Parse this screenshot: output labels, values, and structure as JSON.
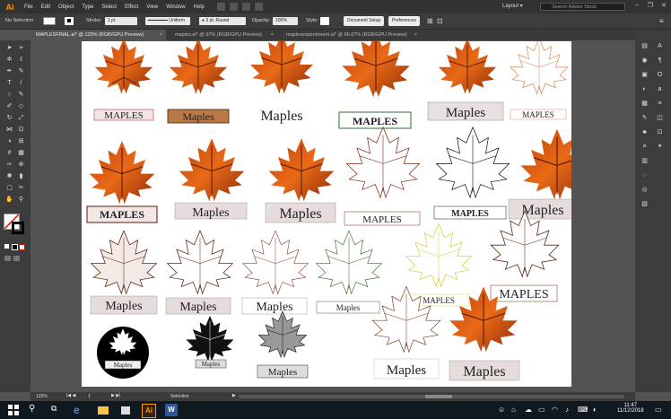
{
  "app": {
    "logo": "Ai",
    "menu": [
      "File",
      "Edit",
      "Object",
      "Type",
      "Select",
      "Effect",
      "View",
      "Window",
      "Help"
    ],
    "workspace": "Layout",
    "search_placeholder": "Search Adobe Stock",
    "accent": "#ff9a00"
  },
  "control_bar": {
    "selection": "No Selection",
    "stroke_label": "Stroke:",
    "stroke_value": "1 pt",
    "profile": "Uniform",
    "brush": "3 pt. Round",
    "opacity_label": "Opacity:",
    "opacity_value": "100%",
    "style_label": "Style:",
    "doc_setup": "Document Setup",
    "preferences": "Preferences"
  },
  "tabs": [
    {
      "label": "MAPLESFINAL.ai* @ 125% (RGB/GPU Preview)",
      "active": true
    },
    {
      "label": "maples.ai* @ 97% (RGB/GPU Preview)",
      "active": false
    },
    {
      "label": "maplesexperiement.ai* @ 66.67% (RGB/GPU Preview)",
      "active": false
    }
  ],
  "status_bar": {
    "zoom": "125%",
    "page": "1",
    "tool": "Selection"
  },
  "artwork": {
    "labels": [
      "MAPLES",
      "Maples",
      "Maples",
      "MAPLES",
      "Maples",
      "MAPLES",
      "MAPLES",
      "Maples",
      "Maples",
      "MAPLES",
      "MAPLES",
      "Maples",
      "Maples",
      "Maples",
      "Maples",
      "Maples",
      "MAPLES",
      "MAPLES",
      "Maples",
      "Maples",
      "Maples",
      "Maples",
      "Maples"
    ]
  },
  "taskbar": {
    "time": "11:47",
    "date": "11/12/2018"
  }
}
